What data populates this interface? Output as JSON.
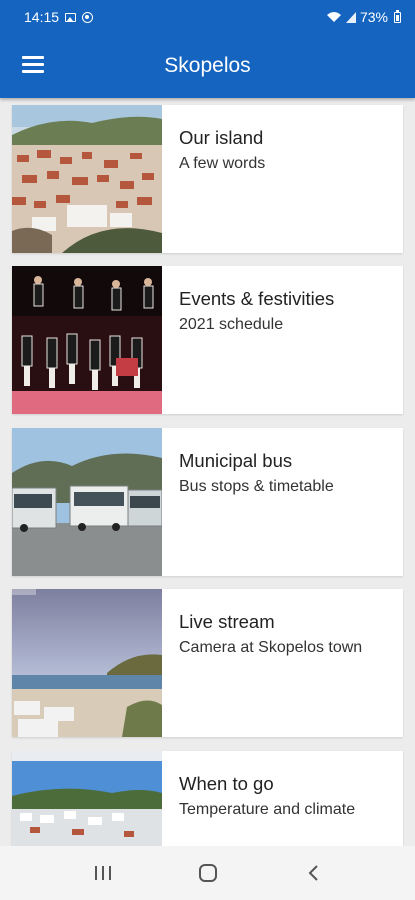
{
  "status_bar": {
    "time": "14:15",
    "battery": "73%",
    "icons": [
      "image-icon",
      "circle-notification-icon",
      "wifi-icon",
      "signal-icon",
      "battery-icon"
    ]
  },
  "app_bar": {
    "title": "Skopelos",
    "menu_icon": "menu-icon"
  },
  "items": [
    {
      "title": "Our island",
      "subtitle": "A few words",
      "image": "town-photo"
    },
    {
      "title": "Events & festivities",
      "subtitle": "2021 schedule",
      "image": "dancers-photo"
    },
    {
      "title": "Municipal bus",
      "subtitle": "Bus stops & timetable",
      "image": "buses-photo"
    },
    {
      "title": "Live stream",
      "subtitle": "Camera at Skopelos town",
      "image": "harbor-camera-photo"
    },
    {
      "title": "When to go",
      "subtitle": "Temperature and climate",
      "image": "village-photo"
    }
  ],
  "nav_bar": {
    "icons": [
      "recent-apps-icon",
      "home-icon",
      "back-icon"
    ]
  },
  "colors": {
    "primary": "#1565c0",
    "background": "#ececec"
  }
}
